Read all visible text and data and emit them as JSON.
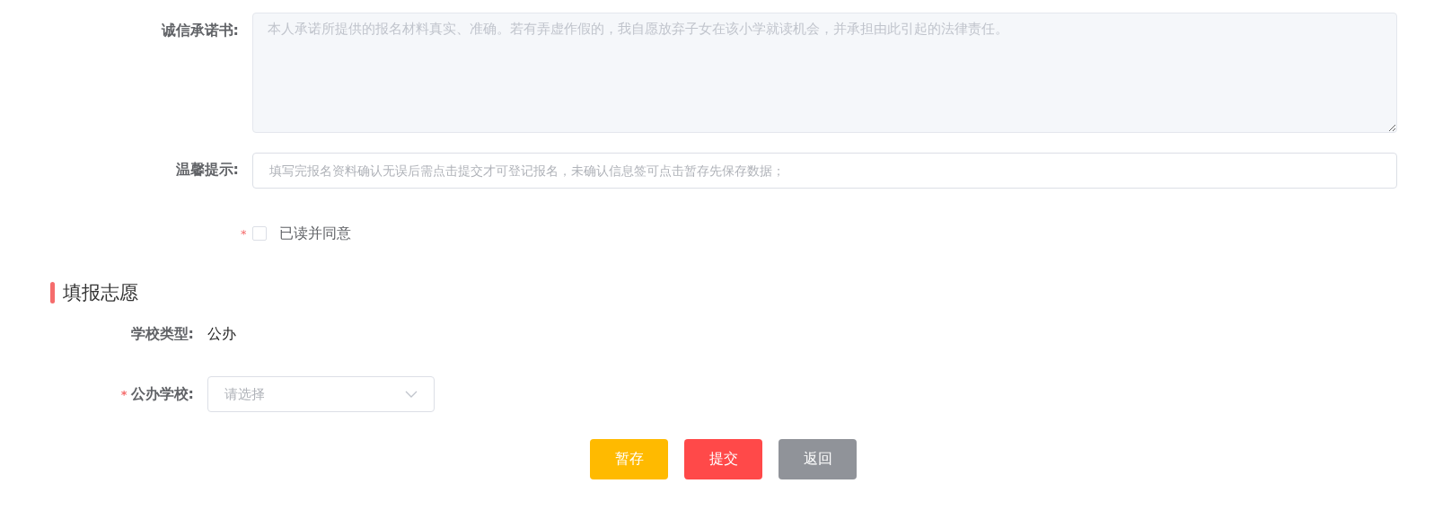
{
  "pledge": {
    "label": "诚信承诺书:",
    "value": "本人承诺所提供的报名材料真实、准确。若有弄虚作假的，我自愿放弃子女在该小学就读机会，并承担由此引起的法律责任。",
    "disabled": true
  },
  "hint": {
    "label": "温馨提示:",
    "placeholder": "填写完报名资料确认无误后需点击提交才可登记报名，未确认信息签可点击暂存先保存数据；"
  },
  "agree": {
    "required_mark": "*",
    "label": "已读并同意",
    "checked": false
  },
  "section": {
    "title": "填报志愿"
  },
  "school_type": {
    "label": "学校类型:",
    "value": "公办"
  },
  "public_school": {
    "required_mark": "*",
    "label": "公办学校:",
    "placeholder": "请选择"
  },
  "buttons": [
    {
      "label": "暂存",
      "kind": "warning"
    },
    {
      "label": "提交",
      "kind": "danger"
    },
    {
      "label": "返回",
      "kind": "info"
    }
  ]
}
